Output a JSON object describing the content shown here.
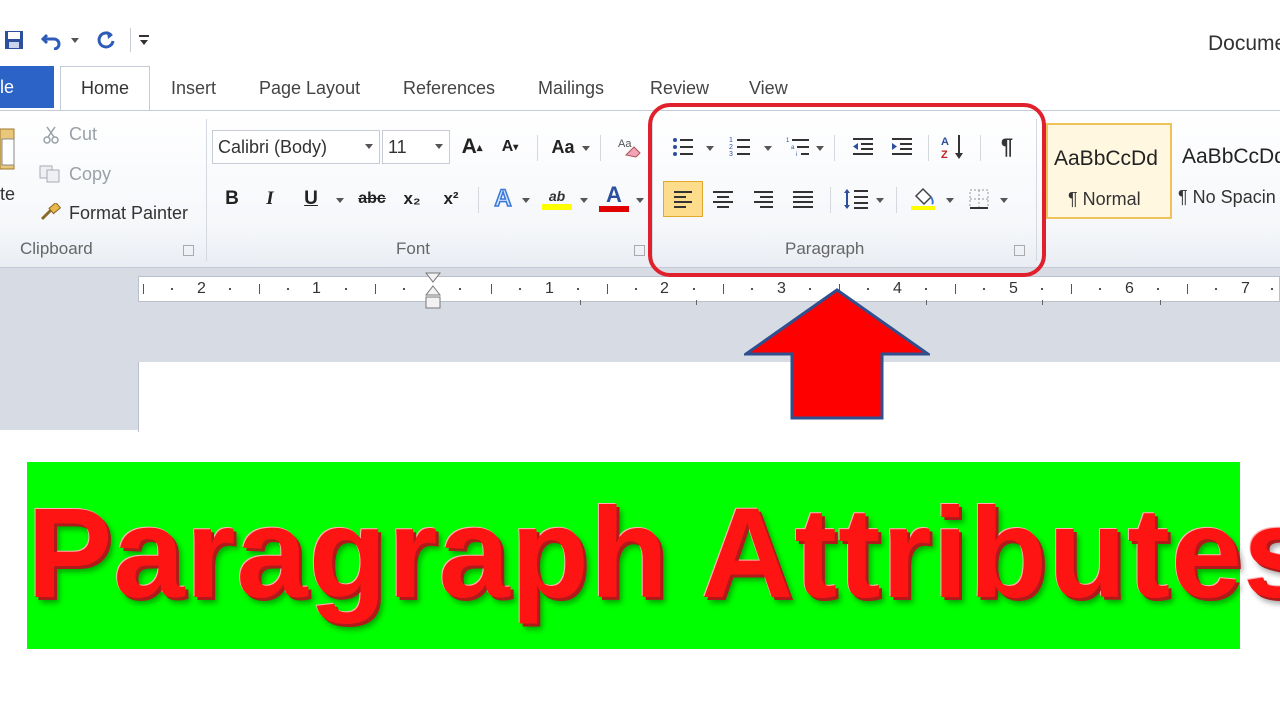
{
  "window": {
    "document_title": "Docume"
  },
  "qat": {
    "save_icon": "save-icon",
    "undo_icon": "undo-icon",
    "redo_icon": "redo-icon"
  },
  "tabs": [
    {
      "label": "ile"
    },
    {
      "label": "Home"
    },
    {
      "label": "Insert"
    },
    {
      "label": "Page Layout"
    },
    {
      "label": "References"
    },
    {
      "label": "Mailings"
    },
    {
      "label": "Review"
    },
    {
      "label": "View"
    }
  ],
  "clipboard": {
    "paste_label": "te",
    "cut_label": "Cut",
    "copy_label": "Copy",
    "format_painter_label": "Format Painter",
    "group_label": "Clipboard"
  },
  "font": {
    "font_name": "Calibri (Body)",
    "font_size": "11",
    "change_case_label": "Aa",
    "bold_label": "B",
    "italic_label": "I",
    "underline_label": "U",
    "strike_label": "abc",
    "subscript_label": "x₂",
    "superscript_label": "x²",
    "grow_label": "A",
    "shrink_label": "A",
    "font_color_label": "A",
    "text_effects_label": "A",
    "highlight_label": "ab",
    "group_label": "Font"
  },
  "paragraph": {
    "group_label": "Paragraph",
    "pilcrow": "¶",
    "sort_label": "A↓Z"
  },
  "styles": [
    {
      "sample": "AaBbCcDd",
      "name": "¶ Normal"
    },
    {
      "sample": "AaBbCcDd",
      "name": "¶ No Spacin"
    }
  ],
  "ruler": {
    "numbers": [
      "2",
      "1",
      "1",
      "2",
      "3",
      "4",
      "5",
      "6",
      "7"
    ]
  },
  "banner": {
    "title": "Paragraph Attributes"
  },
  "colors": {
    "ring": "#e0202c",
    "arrow": "#ff0000",
    "banner_bg": "#00ff00",
    "banner_text": "#ff1414",
    "file_tab": "#2b63c6"
  }
}
